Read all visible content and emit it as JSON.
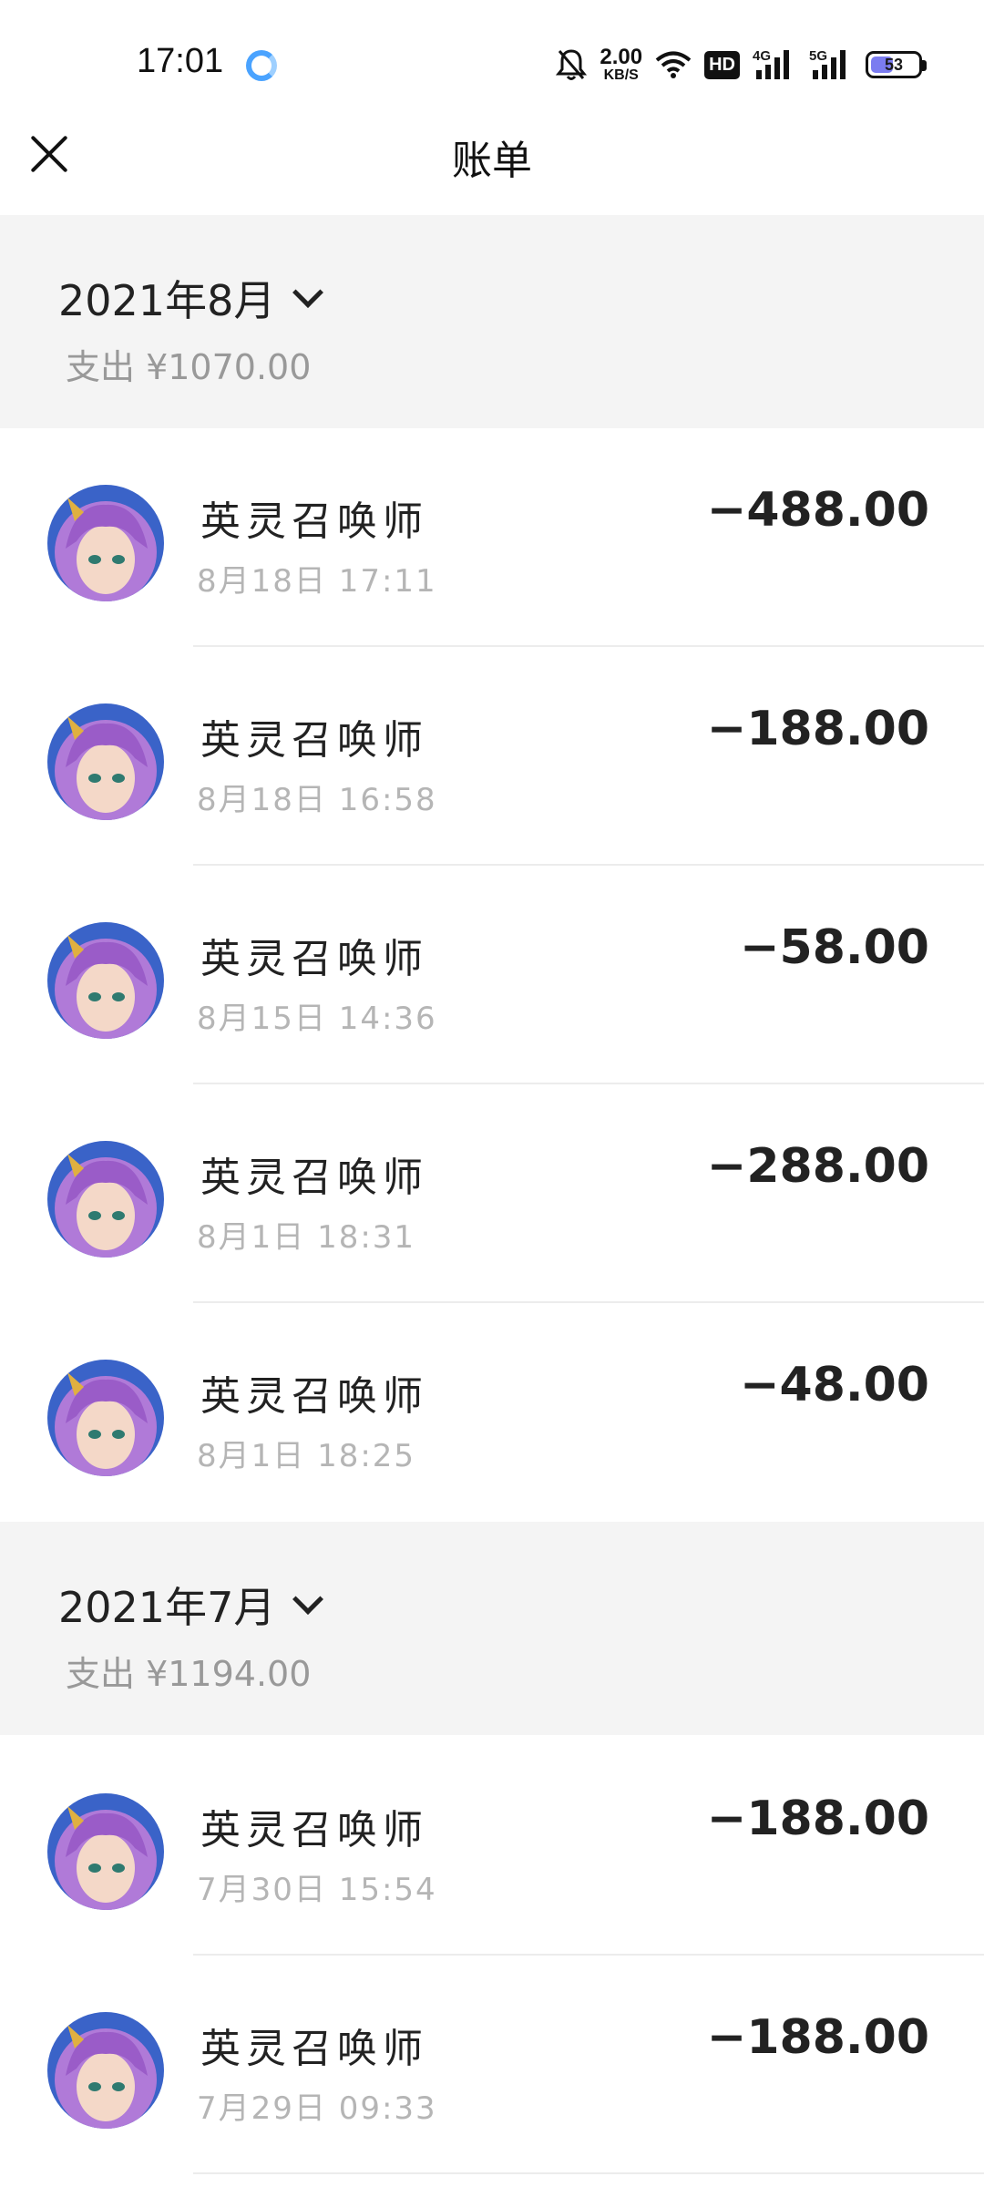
{
  "status_bar": {
    "time": "17:01",
    "net_speed_value": "2.00",
    "net_speed_unit": "KB/S",
    "hd_label": "HD",
    "signal1_label": "4G",
    "signal2_label": "5G",
    "battery": "53",
    "battery_level": 0.53,
    "icons": [
      "mute-bell-icon",
      "wifi-icon",
      "hd-icon",
      "signal-icon",
      "battery-icon"
    ]
  },
  "header": {
    "title": "账单",
    "close_icon": "close-icon"
  },
  "colors": {
    "section_bg": "#f4f4f4",
    "text_primary": "#222222",
    "text_secondary": "#999999",
    "text_time": "#b5b5b5",
    "battery_fill": "#7b7cf0"
  },
  "months": [
    {
      "title": "2021年8月",
      "summary": "支出 ¥1070.00",
      "items": [
        {
          "name": "英灵召唤师",
          "time": "8月18日 17:11",
          "amount": "−488.00"
        },
        {
          "name": "英灵召唤师",
          "time": "8月18日 16:58",
          "amount": "−188.00"
        },
        {
          "name": "英灵召唤师",
          "time": "8月15日 14:36",
          "amount": "−58.00"
        },
        {
          "name": "英灵召唤师",
          "time": "8月1日 18:31",
          "amount": "−288.00"
        },
        {
          "name": "英灵召唤师",
          "time": "8月1日 18:25",
          "amount": "−48.00"
        }
      ]
    },
    {
      "title": "2021年7月",
      "summary": "支出 ¥1194.00",
      "items": [
        {
          "name": "英灵召唤师",
          "time": "7月30日 15:54",
          "amount": "−188.00"
        },
        {
          "name": "英灵召唤师",
          "time": "7月29日 09:33",
          "amount": "−188.00"
        }
      ]
    }
  ]
}
